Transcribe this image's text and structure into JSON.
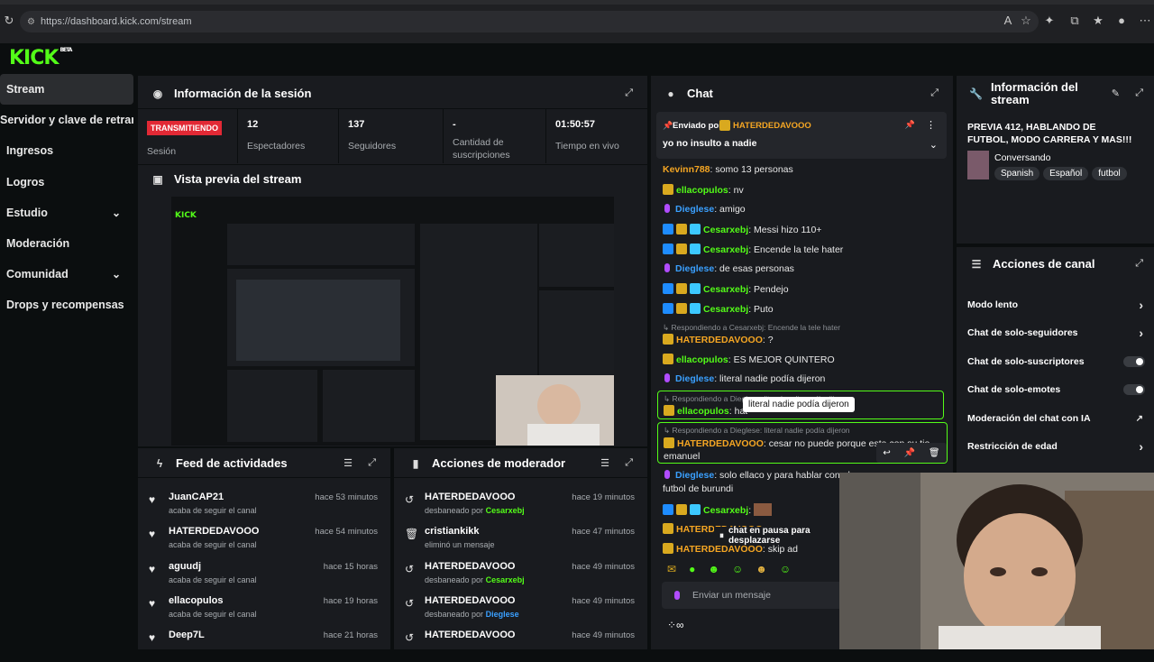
{
  "browser": {
    "url": "https://dashboard.kick.com/stream"
  },
  "logo": {
    "text": "KICK",
    "beta": "BETA"
  },
  "sidebar": {
    "items": [
      {
        "label": "Stream"
      },
      {
        "label": "Servidor y clave de retransmisión"
      },
      {
        "label": "Ingresos"
      },
      {
        "label": "Logros"
      },
      {
        "label": "Estudio"
      },
      {
        "label": "Moderación"
      },
      {
        "label": "Comunidad"
      },
      {
        "label": "Drops y recompensas"
      }
    ]
  },
  "session": {
    "title": "Información de la sesión",
    "status": "TRANSMITIENDO",
    "status_label": "Sesión",
    "stats": [
      {
        "value": "12",
        "label": "Espectadores"
      },
      {
        "value": "137",
        "label": "Seguidores"
      },
      {
        "value": "-",
        "label": "Cantidad de suscripciones"
      },
      {
        "value": "01:50:57",
        "label": "Tiempo en vivo"
      }
    ]
  },
  "preview": {
    "title": "Vista previa del stream"
  },
  "feed": {
    "title": "Feed de actividades",
    "items": [
      {
        "name": "JuanCAP21",
        "sub": "acaba de seguir el canal",
        "time": "hace 53 minutos"
      },
      {
        "name": "HATERDEDAVOOO",
        "sub": "acaba de seguir el canal",
        "time": "hace 54 minutos"
      },
      {
        "name": "aguudj",
        "sub": "acaba de seguir el canal",
        "time": "hace 15 horas"
      },
      {
        "name": "ellacopulos",
        "sub": "acaba de seguir el canal",
        "time": "hace 19 horas"
      },
      {
        "name": "Deep7L",
        "sub": "",
        "time": "hace 21 horas"
      }
    ]
  },
  "modactions": {
    "title": "Acciones de moderador",
    "items": [
      {
        "name": "HATERDEDAVOOO",
        "sub": "desbaneado por",
        "by": "Cesarxebj",
        "time": "hace 19 minutos"
      },
      {
        "name": "cristiankikk",
        "sub": "eliminó un mensaje",
        "by": "",
        "time": "hace 47 minutos"
      },
      {
        "name": "HATERDEDAVOOO",
        "sub": "desbaneado por",
        "by": "Cesarxebj",
        "time": "hace 49 minutos"
      },
      {
        "name": "HATERDEDAVOOO",
        "sub": "desbaneado por",
        "by": "Dieglese",
        "time": "hace 49 minutos"
      },
      {
        "name": "HATERDEDAVOOO",
        "sub": "",
        "by": "",
        "time": "hace 49 minutos"
      }
    ]
  },
  "chat": {
    "title": "Chat",
    "pinned": {
      "by_label": "Enviado por",
      "user": "HATERDEDAVOOO",
      "text": "yo no insulto a nadie"
    },
    "messages": [
      {
        "user": "Kevinn788",
        "text": "somo 13 personas"
      },
      {
        "user": "ellacopulos",
        "text": "nv"
      },
      {
        "user": "Dieglese",
        "text": "amigo"
      },
      {
        "user": "Cesarxebj",
        "text": "Messi hizo 110+"
      },
      {
        "user": "Cesarxebj",
        "text": "Encende la tele hater"
      },
      {
        "user": "Dieglese",
        "text": "de esas personas"
      },
      {
        "user": "Cesarxebj",
        "text": "Pendejo"
      },
      {
        "user": "Cesarxebj",
        "text": "Puto"
      },
      {
        "reply": "Respondiendo a Cesarxebj: Encende la tele hater"
      },
      {
        "user": "HATERDEDAVOOO",
        "text": "?"
      },
      {
        "user": "ellacopulos",
        "text": "ES MEJOR QUINTERO"
      },
      {
        "user": "Dieglese",
        "text": "literal nadie podía dijeron"
      },
      {
        "reply": "Respondiendo a Dieglese: literal nadie podía dijeron"
      },
      {
        "user": "ellacopulos",
        "text": "hat"
      },
      {
        "reply": "Respondiendo a Dieglese: literal nadie podía dijeron"
      },
      {
        "user": "HATERDEDAVOOO",
        "text": "cesar no puede porque esta con su tio"
      },
      {
        "text": "emanuel"
      },
      {
        "user": "Dieglese",
        "text": "solo ellaco y para hablar con el"
      },
      {
        "text": "futbol de burundi"
      },
      {
        "user": "Cesarxebj",
        "text": ""
      },
      {
        "user": "HATERDEDAVOOO",
        "text": ""
      },
      {
        "user": "HATERDEDAVOOO",
        "text": "skip ad"
      }
    ],
    "tooltip": "literal nadie podía dijeron",
    "paused": "chat en pausa para desplazarse",
    "input_placeholder": "Enviar un mensaje"
  },
  "streaminfo": {
    "title": "Información del stream",
    "stream_title": "PREVIA 412, HABLANDO DE FUTBOL, MODO CARRERA Y MAS!!!",
    "category": "Conversando",
    "tags": [
      "Spanish",
      "Español",
      "futbol"
    ]
  },
  "channel": {
    "title": "Acciones de canal",
    "items": [
      {
        "label": "Modo lento",
        "kind": "arrow"
      },
      {
        "label": "Chat de solo-seguidores",
        "kind": "arrow"
      },
      {
        "label": "Chat de solo-suscriptores",
        "kind": "toggle"
      },
      {
        "label": "Chat de solo-emotes",
        "kind": "toggle"
      },
      {
        "label": "Moderación del chat con IA",
        "kind": "external"
      },
      {
        "label": "Restricción de edad",
        "kind": "arrow"
      }
    ]
  }
}
